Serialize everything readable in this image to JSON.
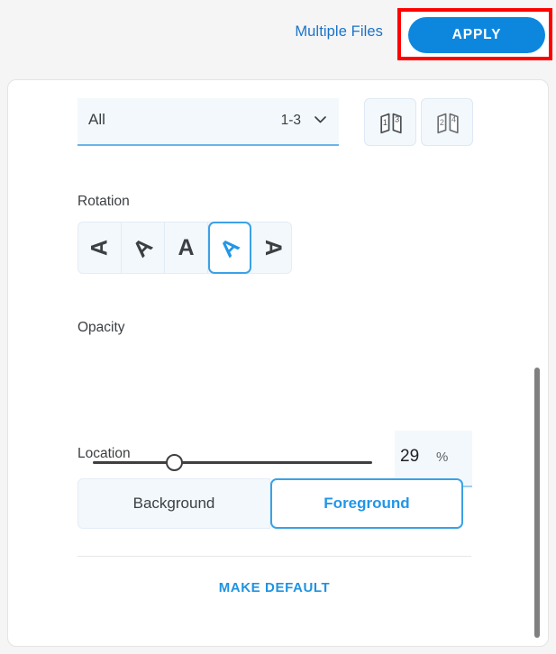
{
  "colors": {
    "accent_blue": "#0d87de",
    "link_blue": "#1a73c8",
    "selected_blue": "#2196e8",
    "highlight_red": "#ff0000",
    "field_bg": "#f3f8fc",
    "page_bg": "#f5f5f5",
    "card_bg": "#ffffff",
    "slider_track": "#3f3f3f",
    "scrollbar": "#808080"
  },
  "topbar": {
    "multiple_files_label": "Multiple Files",
    "apply_label": "APPLY",
    "apply_highlighted": true
  },
  "panel": {
    "pages": {
      "select_label": "All",
      "range_value": "1-3",
      "chevron_icon": "chevron-down-icon",
      "odd_pages_button": {
        "icon": "odd-pages-icon",
        "page_numbers": [
          "1",
          "3"
        ]
      },
      "even_pages_button": {
        "icon": "even-pages-icon",
        "page_numbers": [
          "2",
          "4"
        ]
      }
    },
    "rotation": {
      "label": "Rotation",
      "glyph": "A",
      "options": [
        {
          "name": "rotate-minus-90",
          "angle": -90,
          "selected": false
        },
        {
          "name": "rotate-minus-45",
          "angle": -45,
          "selected": false
        },
        {
          "name": "rotate-0",
          "angle": 0,
          "selected": false
        },
        {
          "name": "rotate-plus-45",
          "angle": 45,
          "selected": true
        },
        {
          "name": "rotate-plus-90",
          "angle": 90,
          "selected": false
        }
      ]
    },
    "opacity": {
      "label": "Opacity",
      "value": "29",
      "unit": "%",
      "min": 0,
      "max": 100,
      "percent": 29
    },
    "location": {
      "label": "Location",
      "options": [
        {
          "label": "Background",
          "selected": false
        },
        {
          "label": "Foreground",
          "selected": true
        }
      ]
    },
    "make_default_label": "MAKE DEFAULT",
    "scrollbar": {
      "visible": true,
      "thumb_position_percent": 51
    }
  }
}
